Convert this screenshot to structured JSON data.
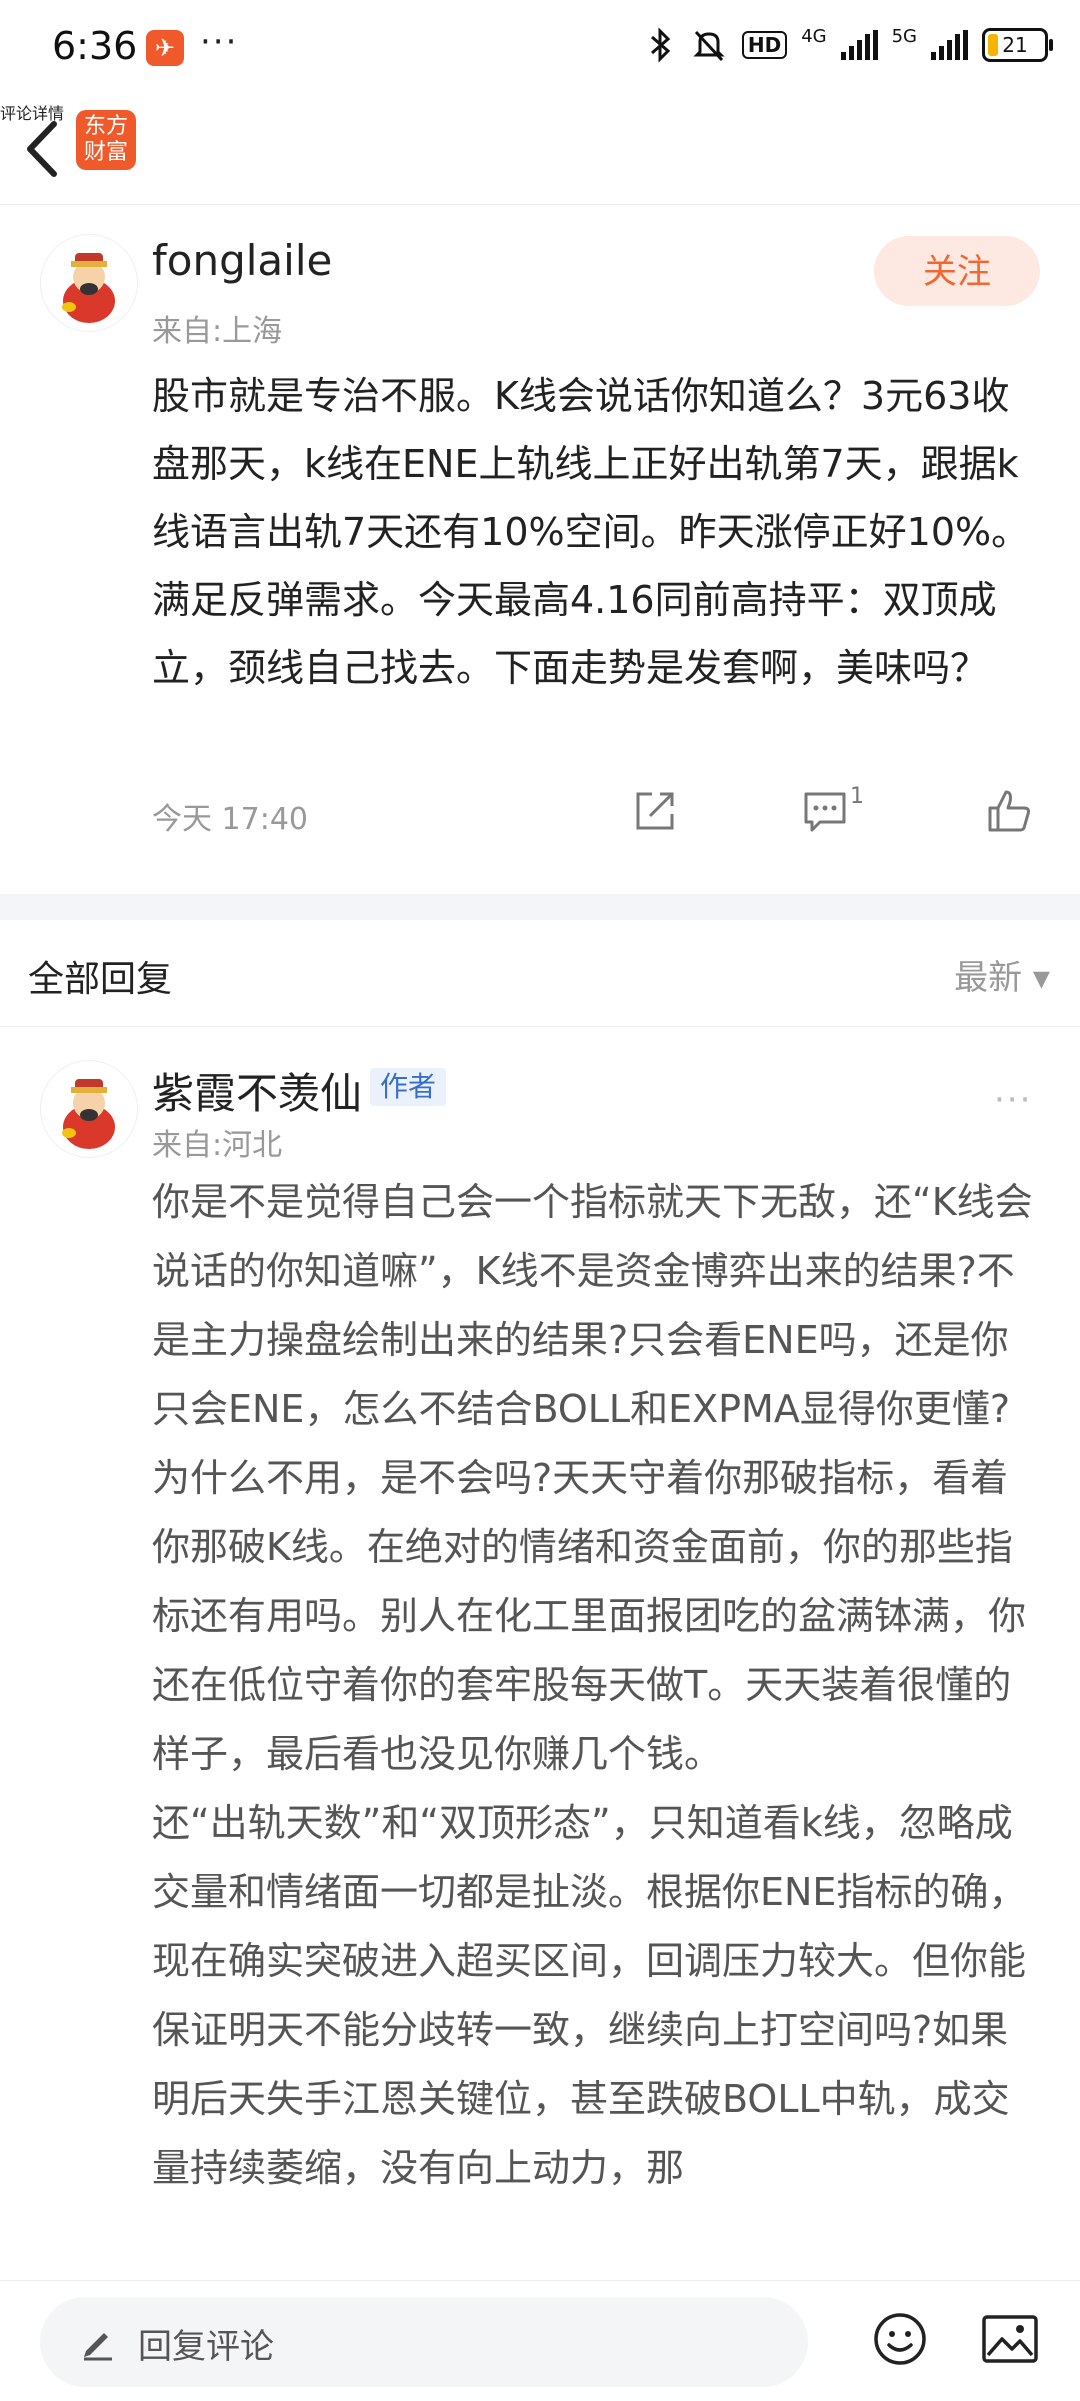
{
  "status_bar": {
    "time": "6:36",
    "app_badge": "✈",
    "dots": "···",
    "hd": "HD",
    "net1": "4G",
    "net2": "5G",
    "battery": "21"
  },
  "header": {
    "logo_line1": "东方",
    "logo_line2": "财富",
    "title": "评论详情"
  },
  "post": {
    "username": "fonglaile",
    "location": "来自:上海",
    "follow_label": "关注",
    "text": "股市就是专治不服。K线会说话你知道么？3元63收盘那天，k线在ENE上轨线上正好出轨第7天，跟据k线语言出轨7天还有10%空间。昨天涨停正好10%。满足反弹需求。今天最高4.16同前高持平：双顶成立，颈线自己找去。下面走势是发套啊，美味吗？",
    "time": "今天 17:40",
    "comment_count": "1"
  },
  "replies_bar": {
    "label": "全部回复",
    "sort": "最新 ▾"
  },
  "reply": {
    "username": "紫霞不羡仙",
    "author_tag": "作者",
    "location": "来自:河北",
    "more": "···",
    "text": "你是不是觉得自己会一个指标就天下无敌，还“K线会说话的你知道嘛”，K线不是资金博弈出来的结果?不是主力操盘绘制出来的结果?只会看ENE吗，还是你只会ENE，怎么不结合BOLL和EXPMA显得你更懂? 为什么不用，是不会吗?天天守着你那破指标，看着你那破K线。在绝对的情绪和资金面前，你的那些指标还有用吗。别人在化工里面报团吃的盆满钵满，你还在低位守着你的套牢股每天做T。天天装着很懂的样子，最后看也没见你赚几个钱。\n还“出轨天数”和“双顶形态”，只知道看k线，忽略成交量和情绪面一切都是扯淡。根据你ENE指标的确，现在确实突破进入超买区间，回调压力较大。但你能保证明天不能分歧转一致，继续向上打空间吗?如果明后天失手江恩关键位，甚至跌破BOLL中轨，成交量持续萎缩，没有向上动力，那"
  },
  "bottom_bar": {
    "placeholder": "回复评论"
  },
  "icons": {
    "back": "chevron-left",
    "share": "share-icon",
    "comment": "comment-icon",
    "like": "thumb-up-icon",
    "emoji": "emoji-icon",
    "image": "image-icon"
  },
  "colors": {
    "accent": "#f2672f",
    "follow_bg": "#fde8e2",
    "author_tag_bg": "#eaf1fb",
    "author_tag_text": "#3a6fc6"
  }
}
